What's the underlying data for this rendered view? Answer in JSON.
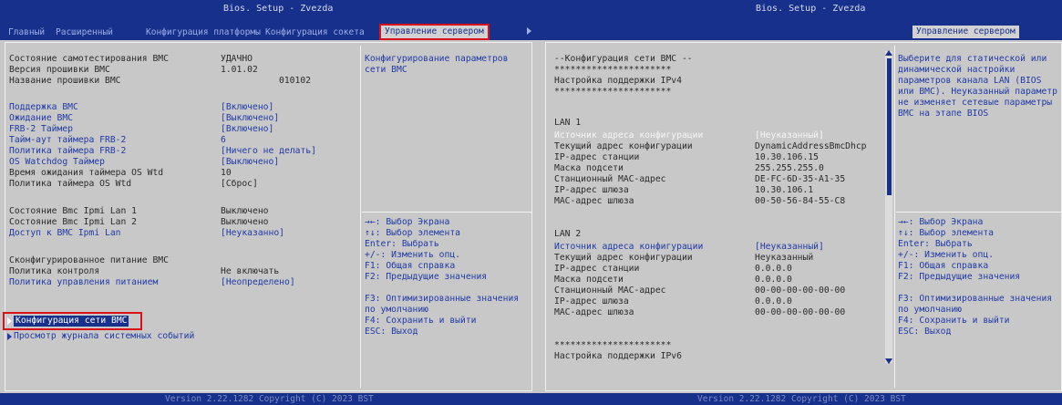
{
  "left": {
    "title": "Bios. Setup - Zvezda",
    "tabs": [
      "Главный",
      "Расширенный",
      "Конфигурация платформы",
      "Конфигурация сокета",
      "Управление сервером"
    ],
    "items": [
      {
        "label": "Состояние самотестирования BMC",
        "value": "УДАЧНО"
      },
      {
        "label": "Версия прошивки BMC",
        "value": "1.01.02"
      },
      {
        "label": "Название прошивки BMC",
        "value": "010102"
      },
      {
        "label": "Поддержка BMC",
        "value": "[Включено]"
      },
      {
        "label": "Ожидание BMC",
        "value": "[Выключено]"
      },
      {
        "label": "FRB-2 Таймер",
        "value": "[Включено]"
      },
      {
        "label": "Тайм-аут таймера FRB-2",
        "value": "6"
      },
      {
        "label": "Политика таймера FRB-2",
        "value": "[Ничего не делать]"
      },
      {
        "label": "OS Watchdog Таймер",
        "value": "[Выключено]"
      },
      {
        "label": "Время ожидания таймера OS Wtd",
        "value": "10"
      },
      {
        "label": "Политика таймера OS Wtd",
        "value": "[Сброс]"
      },
      {
        "label": "Состояние Bmc Ipmi Lan 1",
        "value": "Выключено"
      },
      {
        "label": "Состояние Bmc Ipmi Lan 2",
        "value": "Выключено"
      },
      {
        "label": "Доступ к BMC Ipmi Lan",
        "value": "[Неуказанно]"
      },
      {
        "label": "Сконфигурированное питание BMC",
        "value": ""
      },
      {
        "label": "Политика контроля",
        "value": "Не включать"
      },
      {
        "label": "Политика управления питанием",
        "value": "[Неопределено]"
      },
      {
        "label": "Конфигурация сети BMC",
        "value": ""
      },
      {
        "label": "Просмотр журнала системных событий",
        "value": ""
      }
    ],
    "help_top": [
      "Конфигурирование параметров",
      "сети BMC"
    ],
    "help_keys": [
      "→←: Выбор Экрана",
      "↑↓: Выбор элемента",
      "Enter: Выбрать",
      "+/-: Изменить опц.",
      "F1: Общая справка",
      "F2: Предыдущие значения",
      "F3: Оптимизированные значения",
      "по умолчанию",
      "F4: Сохранить и выйти",
      "ESC: Выход"
    ],
    "footer": "Version 2.22.1282 Copyright (C) 2023 BST"
  },
  "right": {
    "title": "Bios. Setup - Zvezda",
    "tab": "Управление сервером",
    "lines": [
      {
        "label": "--Конфигурация сети BMC --",
        "value": ""
      },
      {
        "label": "**********************",
        "value": ""
      },
      {
        "label": "Настройка поддержки IPv4",
        "value": ""
      },
      {
        "label": "**********************",
        "value": ""
      },
      {
        "label": "LAN 1",
        "value": ""
      },
      {
        "label": "Источник адреса конфигурации",
        "value": "[Неуказанный]"
      },
      {
        "label": "Текущий адрес конфигурации",
        "value": "DynamicAddressBmcDhcp"
      },
      {
        "label": "IP-адрес станции",
        "value": "10.30.106.15"
      },
      {
        "label": "Маска подсети",
        "value": "255.255.255.0"
      },
      {
        "label": "Станционный MAC-адрес",
        "value": "DE-FC-6D-35-A1-35"
      },
      {
        "label": "IP-адрес шлюза",
        "value": "10.30.106.1"
      },
      {
        "label": "MAC-адрес шлюза",
        "value": "00-50-56-84-55-C8"
      },
      {
        "label": "LAN 2",
        "value": ""
      },
      {
        "label": "Источник адреса конфигурации",
        "value": "[Неуказанный]"
      },
      {
        "label": "Текущий адрес конфигурации",
        "value": "Неуказанный"
      },
      {
        "label": "IP-адрес станции",
        "value": "0.0.0.0"
      },
      {
        "label": "Маска подсети",
        "value": "0.0.0.0"
      },
      {
        "label": "Станционный MAC-адрес",
        "value": "00-00-00-00-00-00"
      },
      {
        "label": "IP-адрес шлюза",
        "value": "0.0.0.0"
      },
      {
        "label": "MAC-адрес шлюза",
        "value": "00-00-00-00-00-00"
      },
      {
        "label": "**********************",
        "value": ""
      },
      {
        "label": "Настройка поддержки IPv6",
        "value": ""
      }
    ],
    "help_top": [
      "Выберите для статической или",
      "динамической настройки",
      "параметров канала LAN (BIOS",
      "или BMC). Неуказанный параметр",
      "не изменяет сетевые параметры",
      "BMC на этапе BIOS"
    ],
    "help_keys": [
      "→←: Выбор Экрана",
      "↑↓: Выбор элемента",
      "Enter: Выбрать",
      "+/-: Изменить опц.",
      "F1: Общая справка",
      "F2: Предыдущие значения",
      "F3: Оптимизированные значения",
      "по умолчанию",
      "F4: Сохранить и выйти",
      "ESC: Выход"
    ],
    "footer": "Version 2.22.1282 Copyright (C) 2023 BST"
  },
  "colors": {
    "accent": "#16308c",
    "link": "#1f3aa6",
    "highlight_border": "#d9121a",
    "background": "#c8c8c8"
  }
}
